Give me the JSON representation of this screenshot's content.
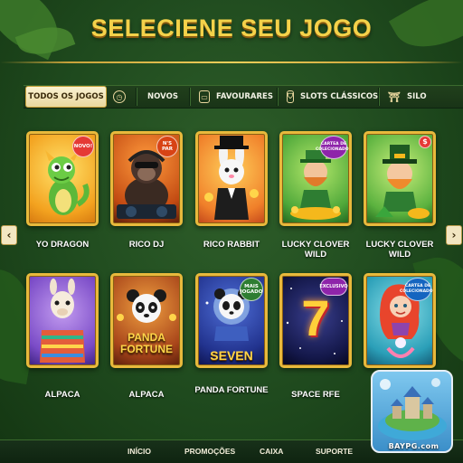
{
  "header": {
    "title": "SELECIENE SEU JOGO"
  },
  "tabs": [
    {
      "label": "TODOS OS JOGOS",
      "icon": "clock-icon",
      "active": true
    },
    {
      "label": "NOVOS",
      "icon": "",
      "active": false
    },
    {
      "label": "FAVOURARES",
      "icon": "folder-icon",
      "active": false
    },
    {
      "label": "SLOTS CLÁSSICOS",
      "icon": "shield-icon",
      "active": false
    },
    {
      "label": "SILO",
      "icon": "pillar-icon",
      "active": false
    }
  ],
  "arrows": {
    "left": "‹",
    "right": "›"
  },
  "games": [
    {
      "label": "YO DRAGON",
      "badge": "NOVO!",
      "badge_color": "#e53935",
      "art": "dragon"
    },
    {
      "label": "RICO DJ",
      "badge": "N'S PAR",
      "badge_color": "#d84315",
      "art": "gorilla"
    },
    {
      "label": "RICO RABBIT",
      "badge": "",
      "badge_color": "",
      "art": "rabbit"
    },
    {
      "label": "LUCKY CLOVER WILD",
      "badge": "CARTEA DE COLECIONADOR",
      "badge_color": "#8e24aa",
      "art": "leprechaun"
    },
    {
      "label": "LUCKY CLOVER WILD",
      "badge": "$",
      "badge_color": "#e53935",
      "art": "leprechaun2"
    },
    {
      "label": "ALPACA",
      "badge": "",
      "badge_color": "",
      "art": "alpaca"
    },
    {
      "label": "ALPACA",
      "badge": "",
      "badge_color": "",
      "art": "panda",
      "card_text": "PANDA FORTUNE"
    },
    {
      "label": "PANDA FORTUNE",
      "badge": "MAIS JOGADO",
      "badge_color": "#2e7d32",
      "art": "panda2",
      "card_text": "SEVEN"
    },
    {
      "label": "SPACE RFE",
      "badge": "EXCLUSIVO",
      "badge_color": "#8e24aa",
      "art": "seven",
      "card_text": "7"
    },
    {
      "label": "",
      "badge": "CARTEA DE COLECIONADOR",
      "badge_color": "#1565c0",
      "art": "mermaid"
    }
  ],
  "bottom_nav": [
    {
      "label": "INÍCIO"
    },
    {
      "label": "PROMOÇÕES"
    },
    {
      "label": "CAIXA"
    },
    {
      "label": "SUPORTE"
    }
  ],
  "promo": {
    "label": "BAYPG.com"
  },
  "colors": {
    "gold": "#e8b93c",
    "title": "#f4d24a",
    "background": "#1f4a1e"
  }
}
